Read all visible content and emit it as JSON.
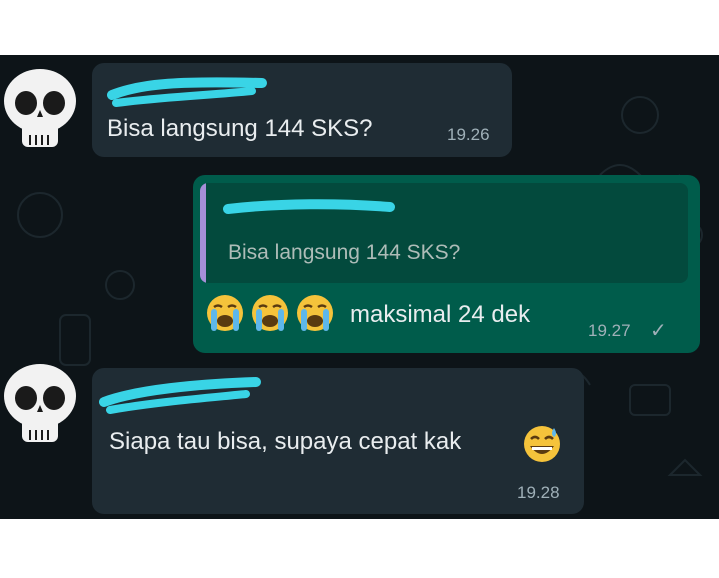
{
  "messages": [
    {
      "sender": "incoming",
      "text": "Bisa langsung 144 SKS?",
      "time": "19.26"
    },
    {
      "sender": "outgoing",
      "quote": {
        "text": "Bisa langsung 144 SKS?"
      },
      "emoji": [
        "loudly-crying-face",
        "loudly-crying-face",
        "loudly-crying-face"
      ],
      "text": "maksimal 24 dek",
      "time": "19.27",
      "status": "✓"
    },
    {
      "sender": "incoming",
      "text": "Siapa tau bisa, supaya cepat kak",
      "emoji": "grinning-face-with-sweat",
      "time": "19.28"
    }
  ],
  "colors": {
    "chat_background": "#0d1418",
    "incoming_bubble": "#1f2c34",
    "outgoing_bubble": "#005c4b",
    "quote_bar": "#a58fd8",
    "redaction": "#39d4e6"
  },
  "icons": [
    "skull-emoji-avatar",
    "skull-emoji-avatar",
    "single-check-icon"
  ]
}
